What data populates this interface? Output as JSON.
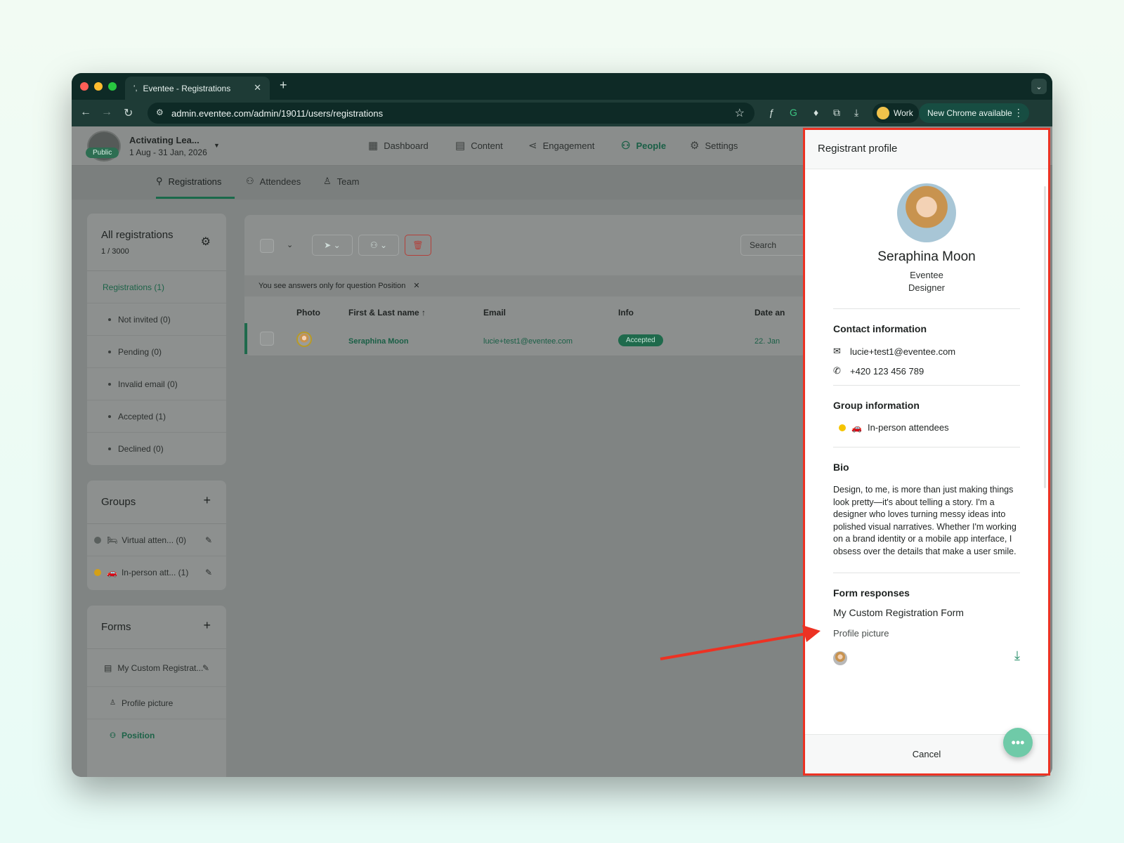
{
  "browser": {
    "tab_title": "Eventee - Registrations",
    "url": "admin.eventee.com/admin/19011/users/registrations",
    "profile_label": "Work",
    "update_label": "New Chrome available"
  },
  "event": {
    "name": "Activating Lea...",
    "dates": "1 Aug - 31 Jan, 2026",
    "badge": "Public"
  },
  "main_nav": [
    {
      "label": "Dashboard",
      "icon": "dashboard-icon"
    },
    {
      "label": "Content",
      "icon": "calendar-icon"
    },
    {
      "label": "Engagement",
      "icon": "share-icon"
    },
    {
      "label": "People",
      "icon": "people-icon",
      "active": true
    },
    {
      "label": "Settings",
      "icon": "gear-icon"
    }
  ],
  "sub_nav": [
    {
      "label": "Registrations",
      "active": true
    },
    {
      "label": "Attendees"
    },
    {
      "label": "Team"
    }
  ],
  "registrations_panel": {
    "title": "All registrations",
    "count": "1 / 3000",
    "items": [
      {
        "label": "Registrations (1)"
      },
      {
        "label": "Not invited (0)"
      },
      {
        "label": "Pending (0)"
      },
      {
        "label": "Invalid email (0)"
      },
      {
        "label": "Accepted (1)"
      },
      {
        "label": "Declined (0)"
      }
    ]
  },
  "groups_panel": {
    "title": "Groups",
    "items": [
      {
        "label": "Virtual atten...  (0)",
        "color": "#5a605e",
        "emoji": "🛏"
      },
      {
        "label": "In-person att...  (1)",
        "color": "#d4a017",
        "emoji": "🚗"
      }
    ]
  },
  "forms_panel": {
    "title": "Forms",
    "items": [
      {
        "label": "My Custom Registrat..."
      },
      {
        "label": "Profile picture"
      },
      {
        "label": "Position"
      }
    ]
  },
  "table": {
    "search_placeholder": "Search",
    "info_text": "You see answers only for question Position",
    "columns": [
      "Photo",
      "First & Last name ↑",
      "Email",
      "Info",
      "Date an"
    ],
    "rows": [
      {
        "name": "Seraphina Moon",
        "email": "lucie+test1@eventee.com",
        "status": "Accepted",
        "date": "22. Jan"
      }
    ]
  },
  "drawer": {
    "title": "Registrant profile",
    "name": "Seraphina Moon",
    "company": "Eventee",
    "position": "Designer",
    "contact_title": "Contact information",
    "email": "lucie+test1@eventee.com",
    "phone": "+420 123 456 789",
    "group_title": "Group information",
    "group_name": "In-person attendees",
    "group_color": "#f5c400",
    "bio_title": "Bio",
    "bio": "Design, to me, is more than just making things look pretty—it's about telling a story. I'm a designer who loves turning messy ideas into polished visual narratives. Whether I'm working on a brand identity or a mobile app interface, I obsess over the details that make a user smile.",
    "form_title": "Form responses",
    "form_name": "My Custom Registration Form",
    "form_question": "Profile picture",
    "cancel_label": "Cancel"
  },
  "annotation": {
    "highlight_color": "#ec3223"
  }
}
